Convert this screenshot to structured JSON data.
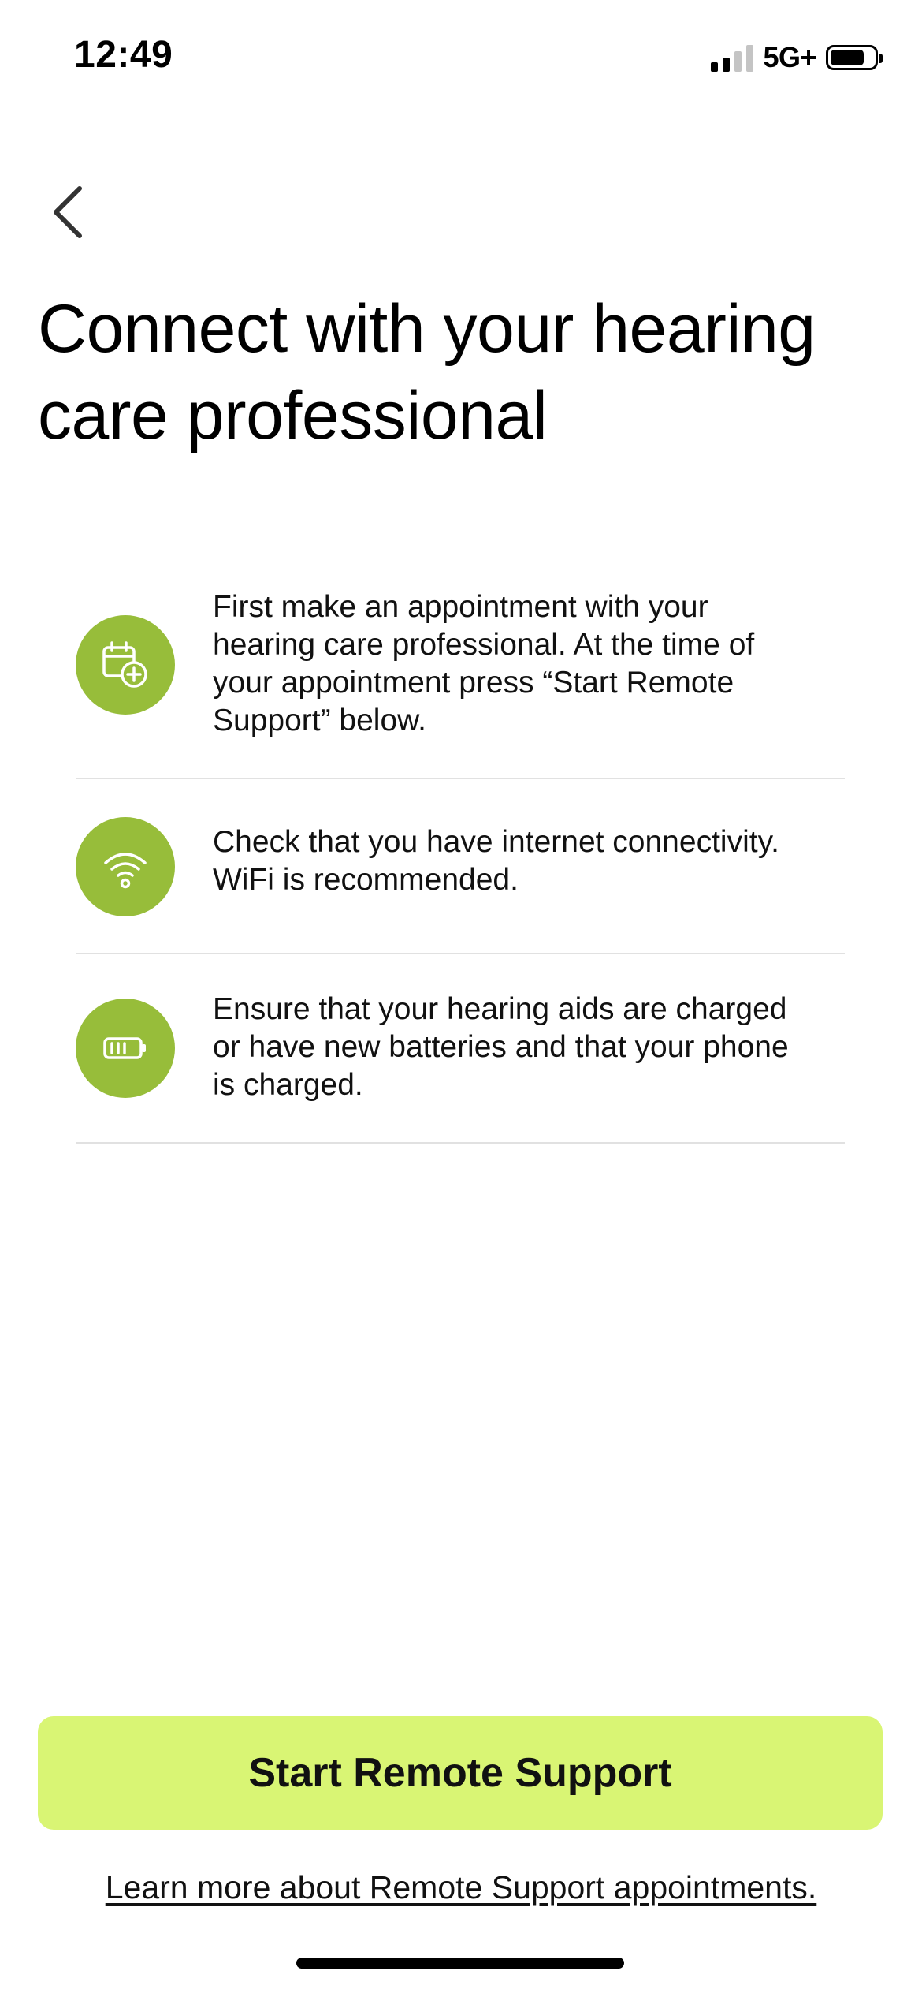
{
  "status_bar": {
    "time": "12:49",
    "network": "5G+",
    "signal_bars_active": 2,
    "signal_bars_total": 4,
    "battery_level": 0.78
  },
  "nav": {
    "back_icon": "chevron-left-icon"
  },
  "header": {
    "title_line1": "Connect with your hearing",
    "title_line2": "care professional"
  },
  "steps": [
    {
      "icon": "calendar-add-icon",
      "text": "First make an appointment with your hearing care professional. At the time of your appointment press “Start Remote Support” below."
    },
    {
      "icon": "wifi-icon",
      "text": "Check that you have internet connectivity. WiFi is recommended."
    },
    {
      "icon": "battery-charge-icon",
      "text": "Ensure that your hearing aids are charged or have new batteries and that your phone is charged."
    }
  ],
  "actions": {
    "start_button_label": "Start Remote Support",
    "learn_more_label": "Learn more about Remote Support appointments."
  },
  "colors": {
    "icon_circle": "#97bd3a",
    "primary_button": "#d9f574",
    "divider": "#e1e1e1"
  }
}
